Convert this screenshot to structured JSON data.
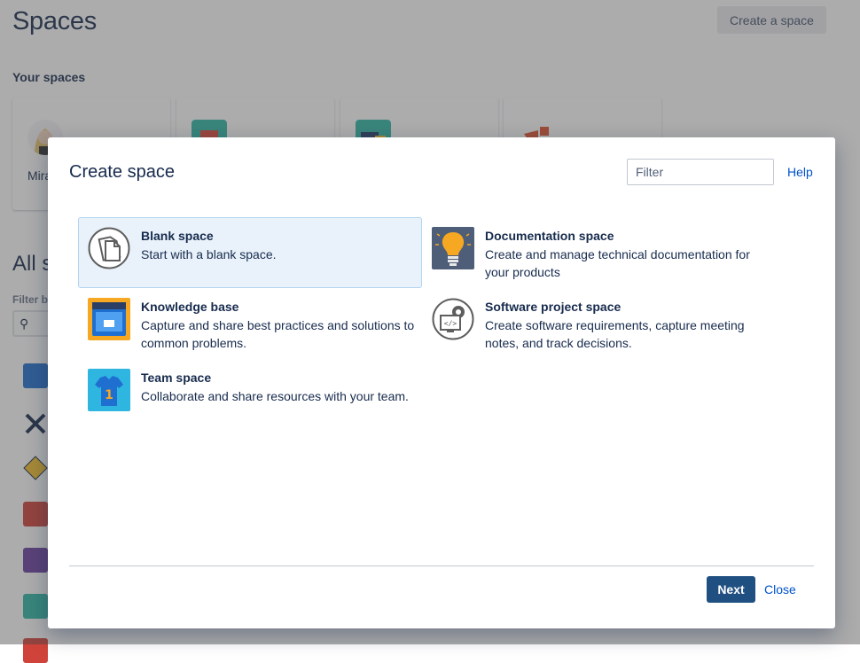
{
  "page": {
    "title": "Spaces",
    "create_button": "Create a space",
    "your_spaces_label": "Your spaces",
    "card_name": "Mira",
    "all_spaces_label": "All s",
    "filter_by_label": "Filter b"
  },
  "dialog": {
    "title": "Create space",
    "filter_placeholder": "Filter",
    "help_link": "Help",
    "tiles": [
      {
        "title": "Blank space",
        "description": "Start with a blank space."
      },
      {
        "title": "Documentation space",
        "description": "Create and manage technical documentation for your products"
      },
      {
        "title": "Knowledge base",
        "description": "Capture and share best practices and solutions to common problems."
      },
      {
        "title": "Software project space",
        "description": "Create software requirements, capture meeting notes, and track decisions."
      },
      {
        "title": "Team space",
        "description": "Collaborate and share resources with your team."
      }
    ],
    "next_button": "Next",
    "close_button": "Close"
  }
}
